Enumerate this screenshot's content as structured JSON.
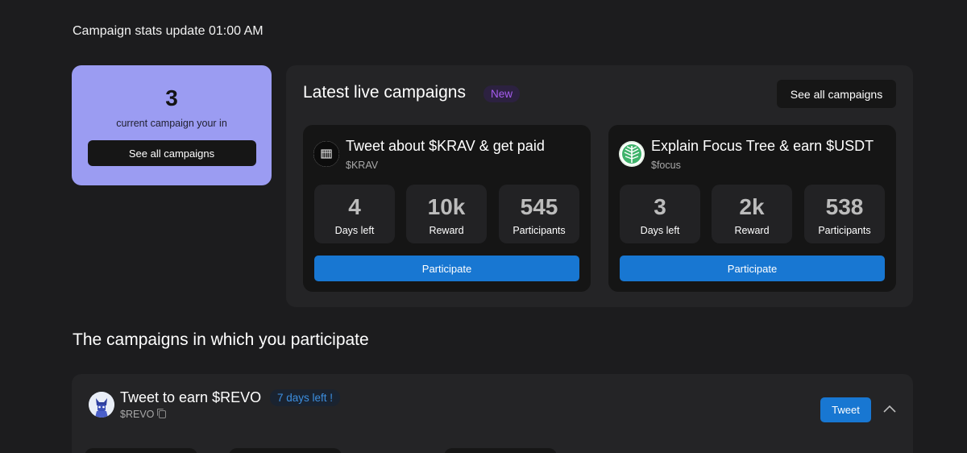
{
  "header": {
    "stats_update": "Campaign stats update 01:00 AM"
  },
  "summary": {
    "count": "3",
    "label": "current campaign your in",
    "button_label": "See all campaigns"
  },
  "live": {
    "title": "Latest live campaigns",
    "badge": "New",
    "see_all_label": "See all campaigns",
    "campaigns": [
      {
        "title": "Tweet about $KRAV & get paid",
        "ticker": "$KRAV",
        "icon": "krav-logo-icon",
        "stats": [
          {
            "value": "4",
            "label": "Days left"
          },
          {
            "value": "10k",
            "label": "Reward"
          },
          {
            "value": "545",
            "label": "Participants"
          }
        ],
        "button_label": "Participate"
      },
      {
        "title": "Explain Focus Tree & earn $USDT",
        "ticker": "$focus",
        "icon": "focus-tree-logo-icon",
        "stats": [
          {
            "value": "3",
            "label": "Days left"
          },
          {
            "value": "2k",
            "label": "Reward"
          },
          {
            "value": "538",
            "label": "Participants"
          }
        ],
        "button_label": "Participate"
      }
    ]
  },
  "participating": {
    "section_title": "The campaigns in which you participate",
    "campaigns": [
      {
        "title": "Tweet to earn $REVO",
        "days_badge": "7 days left !",
        "ticker": "$REVO",
        "icon": "revo-avatar-icon",
        "tweet_label": "Tweet"
      }
    ]
  },
  "colors": {
    "background": "#1c1c1e",
    "summary_card": "#9b9cf2",
    "panel": "#242426",
    "card": "#151515",
    "accent_blue": "#1877d2",
    "new_badge": "#a65df0"
  }
}
